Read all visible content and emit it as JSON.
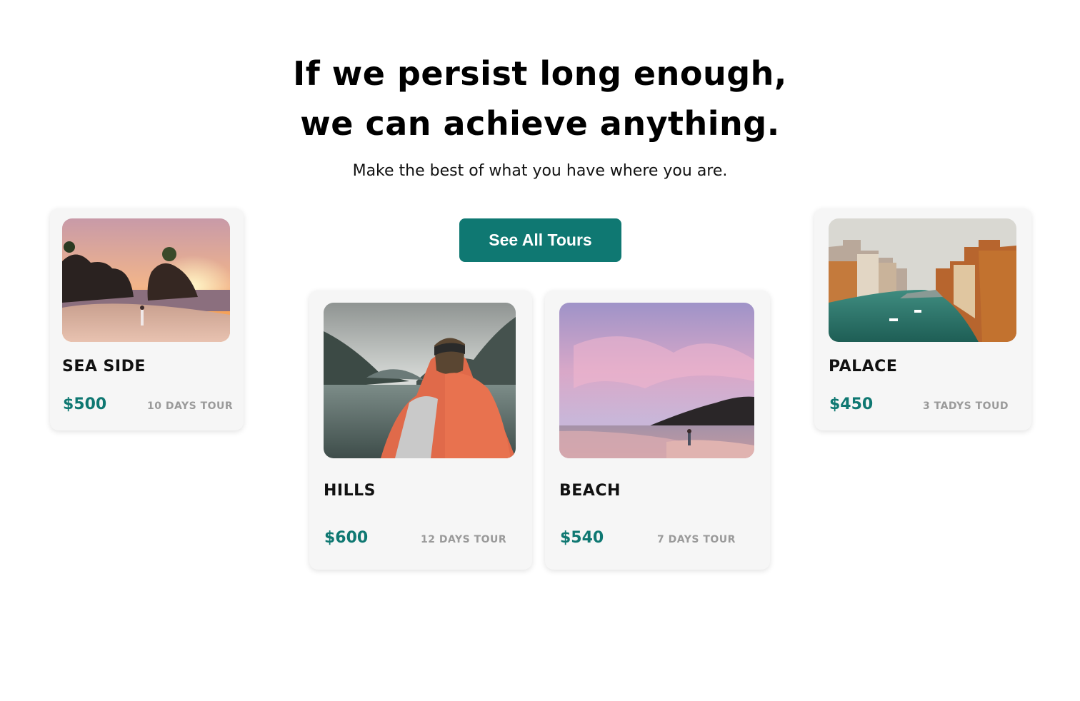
{
  "hero": {
    "headline_line1": "If we persist long enough,",
    "headline_line2": "we can achieve anything.",
    "subtitle": "Make the best of what you have where you are."
  },
  "cta": {
    "label": "See All Tours"
  },
  "tours": [
    {
      "title": "SEA SIDE",
      "price": "$500",
      "duration": "10 DAYS TOUR"
    },
    {
      "title": "HILLS",
      "price": "$600",
      "duration": "12 DAYS TOUR"
    },
    {
      "title": "BEACH",
      "price": "$540",
      "duration": "7 DAYS TOUR"
    },
    {
      "title": "PALACE",
      "price": "$450",
      "duration": "3 TADYS TOUD"
    }
  ],
  "colors": {
    "accent": "#0f7872",
    "card_bg": "#f6f6f6",
    "muted_text": "#9a9a9a"
  }
}
